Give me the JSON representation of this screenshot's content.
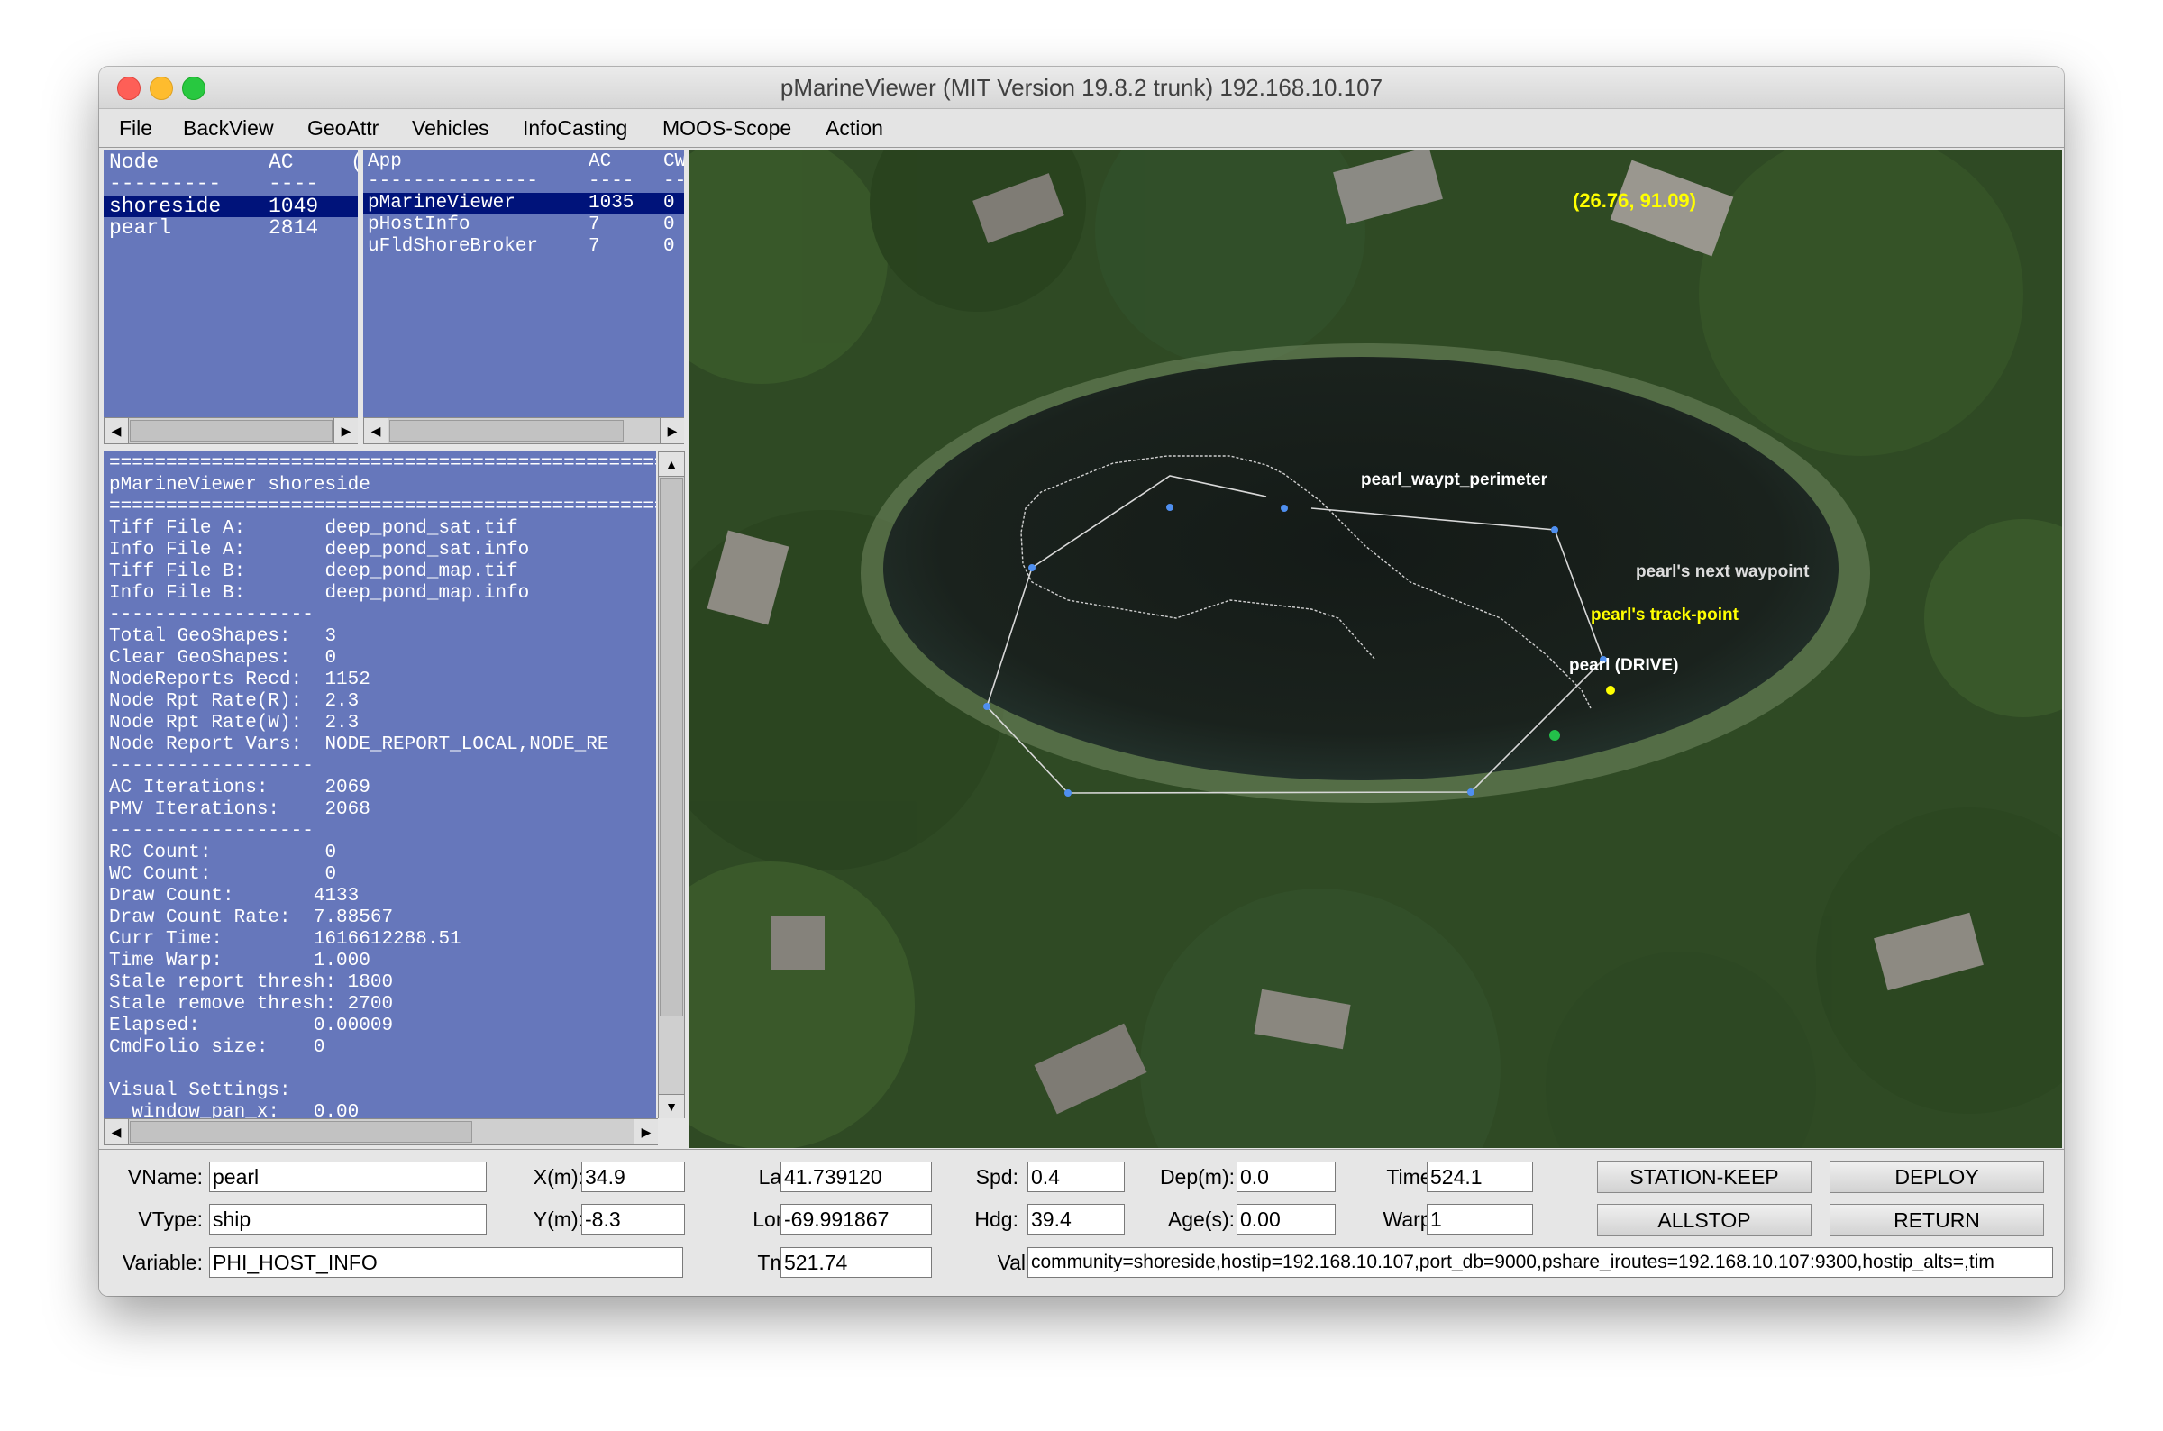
{
  "window": {
    "title": "pMarineViewer (MIT Version 19.8.2 trunk) 192.168.10.107"
  },
  "menu": [
    "File",
    "BackView",
    "GeoAttr",
    "Vehicles",
    "InfoCasting",
    "MOOS-Scope",
    "Action"
  ],
  "node_table": {
    "headers": [
      "Node",
      "AC",
      "("
    ],
    "separator": [
      "---------",
      "----"
    ],
    "rows": [
      {
        "node": "shoreside",
        "ac": "1049",
        "selected": true
      },
      {
        "node": "pearl",
        "ac": "2814",
        "selected": false
      }
    ]
  },
  "app_table": {
    "headers": [
      "App",
      "AC",
      "CW"
    ],
    "separator": [
      "---------------",
      "----",
      "--"
    ],
    "rows": [
      {
        "app": "pMarineViewer",
        "ac": "1035",
        "cw": "0",
        "selected": true
      },
      {
        "app": "pHostInfo",
        "ac": "7",
        "cw": "0",
        "selected": false
      },
      {
        "app": "uFldShoreBroker",
        "ac": "7",
        "cw": "0",
        "selected": false
      }
    ]
  },
  "info_lines": [
    "====================================================",
    "pMarineViewer shoreside",
    "====================================================",
    "Tiff File A:       deep_pond_sat.tif",
    "Info File A:       deep_pond_sat.info",
    "Tiff File B:       deep_pond_map.tif",
    "Info File B:       deep_pond_map.info",
    "------------------",
    "Total GeoShapes:   3",
    "Clear GeoShapes:   0",
    "NodeReports Recd:  1152",
    "Node Rpt Rate(R):  2.3",
    "Node Rpt Rate(W):  2.3",
    "Node Report Vars:  NODE_REPORT_LOCAL,NODE_RE",
    "------------------",
    "AC Iterations:     2069",
    "PMV Iterations:    2068",
    "------------------",
    "RC Count:          0",
    "WC Count:          0",
    "Draw Count:       4133",
    "Draw Count Rate:  7.88567",
    "Curr Time:        1616612288.51",
    "Time Warp:        1.000",
    "Stale report thresh: 1800",
    "Stale remove thresh: 2700",
    "Elapsed:          0.00009",
    "CmdFolio size:    0",
    "",
    "Visual Settings:",
    "  window_pan_x:   0.00"
  ],
  "map": {
    "coords_label": "(26.76, 91.09)",
    "labels": {
      "perimeter": "pearl_waypt_perimeter",
      "next_waypoint": "pearl's next waypoint",
      "track_point": "pearl's track-point",
      "vehicle": "pearl (DRIVE)"
    },
    "colors": {
      "coords": "#ffff00",
      "track_point": "#ffff00",
      "next_waypoint": "#dddddd",
      "vehicle": "#ffffff",
      "waypoint_dot": "#4f8ff0"
    }
  },
  "fields": {
    "vname": {
      "label": "VName:",
      "value": "pearl"
    },
    "vtype": {
      "label": "VType:",
      "value": "ship"
    },
    "variable": {
      "label": "Variable:",
      "value": "PHI_HOST_INFO"
    },
    "x": {
      "label": "X(m):",
      "value": "34.9"
    },
    "y": {
      "label": "Y(m):",
      "value": "-8.3"
    },
    "lat": {
      "label": "Lat:",
      "value": "41.739120"
    },
    "lon": {
      "label": "Lon:",
      "value": "-69.991867"
    },
    "tm": {
      "label": "Tm:",
      "value": "521.74"
    },
    "spd": {
      "label": "Spd:",
      "value": "0.4"
    },
    "hdg": {
      "label": "Hdg:",
      "value": "39.4"
    },
    "dep": {
      "label": "Dep(m):",
      "value": "0.0"
    },
    "age": {
      "label": "Age(s):",
      "value": "0.00"
    },
    "time": {
      "label": "Time:",
      "value": "524.1"
    },
    "warp": {
      "label": "Warp:",
      "value": "1"
    },
    "value": {
      "label": "Value:",
      "value": "community=shoreside,hostip=192.168.10.107,port_db=9000,pshare_iroutes=192.168.10.107:9300,hostip_alts=,tim"
    }
  },
  "buttons": {
    "station_keep": "STATION-KEEP",
    "deploy": "DEPLOY",
    "allstop": "ALLSTOP",
    "return": "RETURN"
  }
}
